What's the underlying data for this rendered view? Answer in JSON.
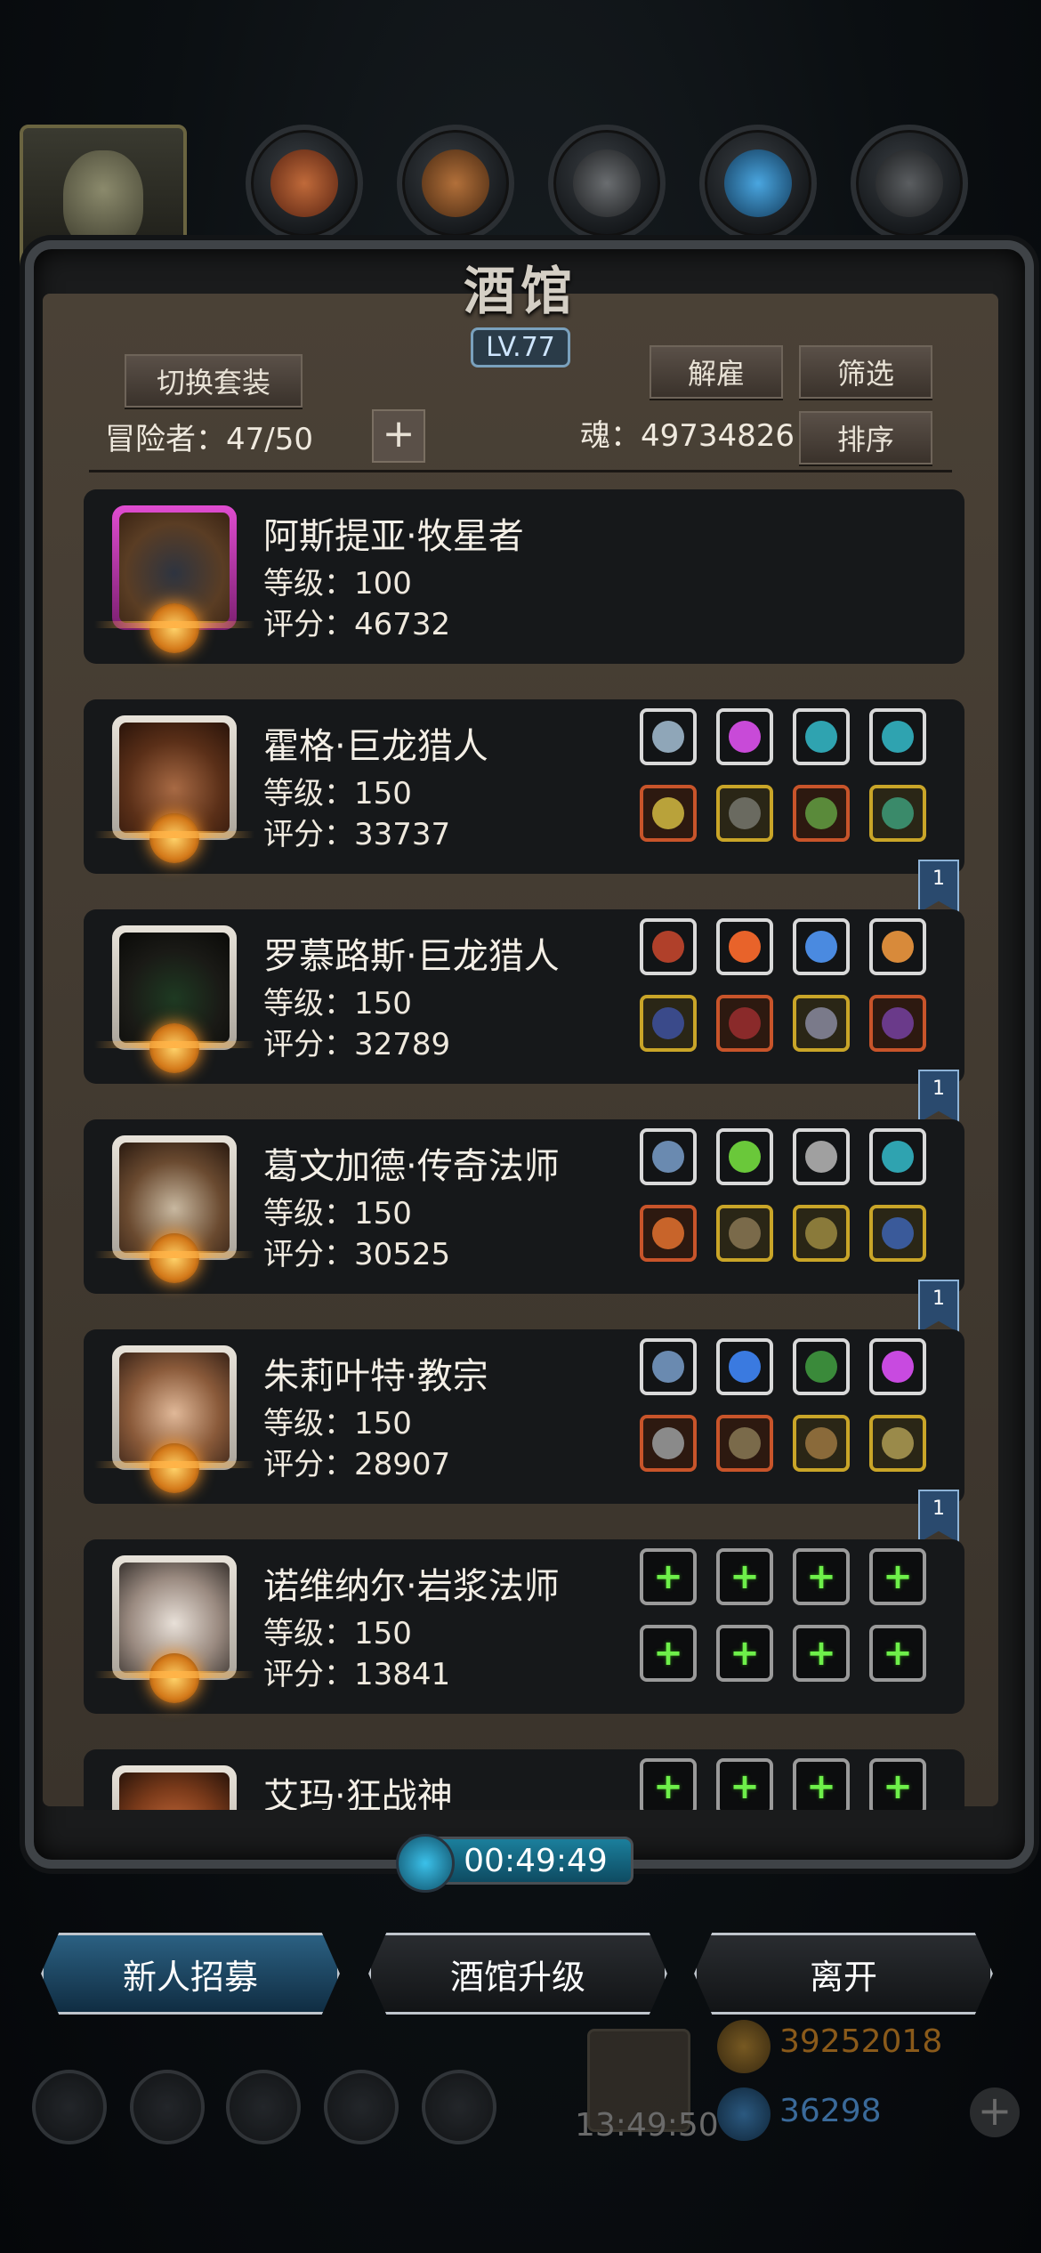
{
  "header": {
    "title": "酒馆",
    "level": "LV.77"
  },
  "controls": {
    "switch_outfit": "切换套装",
    "dismiss": "解雇",
    "filter": "筛选",
    "sort": "排序",
    "plus": "+"
  },
  "stats": {
    "adventurers": "冒险者：47/50",
    "soul": "魂：49734826"
  },
  "heroes": [
    {
      "name": "阿斯提亚·牧星者",
      "level": "等级：100",
      "score": "评分：46732",
      "frame": "purple",
      "equip": []
    },
    {
      "name": "霍格·巨龙猎人",
      "level": "等级：150",
      "score": "评分：33737",
      "frame": "orange",
      "tag": "1",
      "equip": [
        "white",
        "white",
        "white",
        "white",
        "red",
        "gold",
        "red",
        "gold"
      ]
    },
    {
      "name": "罗慕路斯·巨龙猎人",
      "level": "等级：150",
      "score": "评分：32789",
      "frame": "orange",
      "tag": "1",
      "equip": [
        "white",
        "white",
        "white",
        "white",
        "gold",
        "red",
        "gold",
        "red"
      ]
    },
    {
      "name": "葛文加德·传奇法师",
      "level": "等级：150",
      "score": "评分：30525",
      "frame": "orange",
      "tag": "1",
      "equip": [
        "white",
        "white",
        "white",
        "white",
        "red",
        "gold",
        "gold",
        "gold"
      ]
    },
    {
      "name": "朱莉叶特·教宗",
      "level": "等级：150",
      "score": "评分：28907",
      "frame": "orange",
      "tag": "1",
      "equip": [
        "white",
        "white",
        "white",
        "white",
        "red",
        "red",
        "gold",
        "gold"
      ]
    },
    {
      "name": "诺维纳尔·岩浆法师",
      "level": "等级：150",
      "score": "评分：13841",
      "frame": "orange",
      "equip": [
        "empty",
        "empty",
        "empty",
        "empty",
        "empty",
        "empty",
        "empty",
        "empty"
      ]
    },
    {
      "name": "艾玛·狂战神",
      "level": "",
      "score": "",
      "frame": "orange",
      "equip": [
        "empty",
        "empty",
        "empty",
        "empty"
      ]
    }
  ],
  "timer": "00:49:49",
  "bottom_buttons": {
    "recruit": "新人招募",
    "upgrade": "酒馆升级",
    "leave": "离开"
  },
  "hud": {
    "gift_time": "13:49:50",
    "gold": "39252018",
    "gems": "36298"
  },
  "colors": {
    "accent_blue": "#6ed0ff",
    "plus_green": "#6ef04a",
    "gold_text": "#c98a2a"
  }
}
